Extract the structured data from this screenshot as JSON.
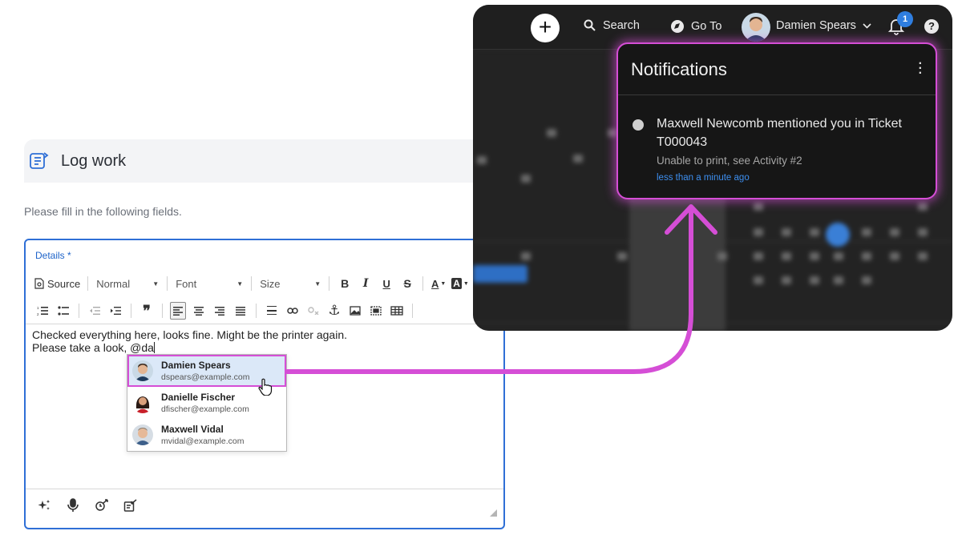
{
  "log_work": {
    "title": "Log work",
    "subtitle": "Please fill in the following fields.",
    "details_label": "Details *",
    "toolbar": {
      "source": "Source",
      "format": "Normal",
      "font": "Font",
      "size": "Size",
      "bold": "B",
      "italic": "I",
      "underline": "U",
      "strike": "S",
      "text_color": "A",
      "bg_color": "A"
    },
    "editor": {
      "line1": "Checked everything here, looks fine. Might be the printer again.",
      "line2": "Please take a look, @da"
    },
    "mentions": [
      {
        "name": "Damien Spears",
        "email": "dspears@example.com",
        "selected": true
      },
      {
        "name": "Danielle Fischer",
        "email": "dfischer@example.com",
        "selected": false
      },
      {
        "name": "Maxwell Vidal",
        "email": "mvidal@example.com",
        "selected": false
      }
    ],
    "footer_icons": [
      "sparkle-icon",
      "microphone-icon",
      "timer-icon",
      "insert-icon"
    ]
  },
  "app": {
    "topbar": {
      "search": "Search",
      "goto": "Go To",
      "user": "Damien Spears",
      "notification_count": "1",
      "help": "?"
    },
    "notifications": {
      "title": "Notifications",
      "items": [
        {
          "text": "Maxwell Newcomb mentioned you in Ticket T000043",
          "subtext": "Unable to print, see Activity #2",
          "time": "less than a minute ago"
        }
      ]
    }
  },
  "colors": {
    "accent_blue": "#2f6fd6",
    "highlight_magenta": "#d54ed6",
    "badge_blue": "#2f7ee0",
    "dark_bg": "#1f1f1f"
  }
}
